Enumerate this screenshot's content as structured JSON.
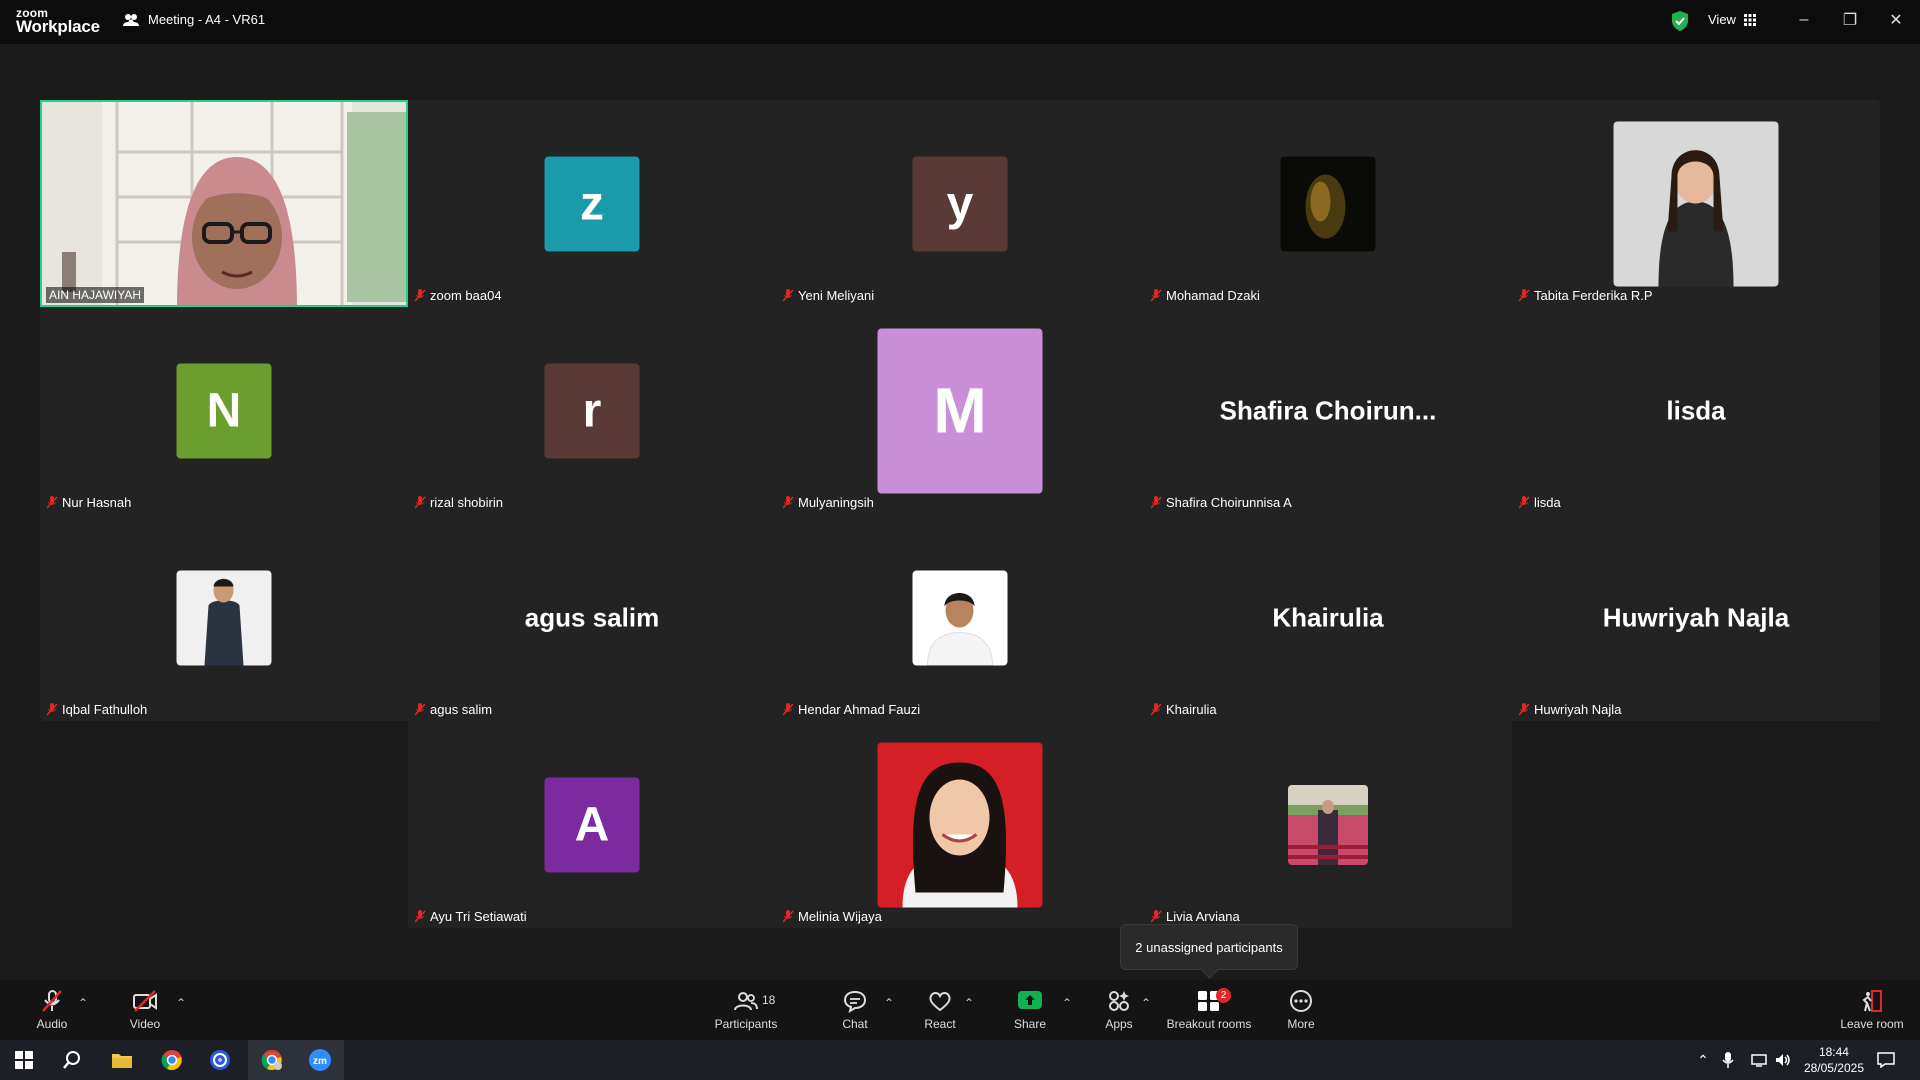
{
  "app": {
    "logo_line1": "zoom",
    "logo_line2": "Workplace",
    "meeting_title": "Meeting - A4 - VR61",
    "view_label": "View"
  },
  "tiles": [
    {
      "name": "AIN HAJAWIYAH",
      "type": "video"
    },
    {
      "name": "zoom baa04",
      "type": "letter",
      "letter": "z",
      "color": "#1a9aab"
    },
    {
      "name": "Yeni Meliyani",
      "type": "letter",
      "letter": "y",
      "color": "#5a3a36"
    },
    {
      "name": "Mohamad Dzaki",
      "type": "photo",
      "photo": "dark-portrait"
    },
    {
      "name": "Tabita Ferderika R.P",
      "type": "photo",
      "photo": "woman-portrait"
    },
    {
      "name": "Nur Hasnah",
      "type": "letter",
      "letter": "N",
      "color": "#6a9e2e"
    },
    {
      "name": "rizal shobirin",
      "type": "letter",
      "letter": "r",
      "color": "#5a3a36"
    },
    {
      "name": "Mulyaningsih",
      "type": "letter-big",
      "letter": "M",
      "color": "#c98fd9"
    },
    {
      "name": "Shafira Choirunnisa A",
      "type": "bigname",
      "display": "Shafira  Choirun..."
    },
    {
      "name": "lisda",
      "type": "bigname",
      "display": "lisda"
    },
    {
      "name": "Iqbal Fathulloh",
      "type": "photo",
      "photo": "man-portrait"
    },
    {
      "name": "agus salim",
      "type": "bigname",
      "display": "agus salim"
    },
    {
      "name": "Hendar Ahmad Fauzi",
      "type": "photo",
      "photo": "man-white-portrait"
    },
    {
      "name": "Khairulia",
      "type": "bigname",
      "display": "Khairulia"
    },
    {
      "name": "Huwriyah Najla",
      "type": "bigname",
      "display": "Huwriyah Najla"
    },
    {
      "name": "Ayu Tri Setiawati",
      "type": "letter",
      "letter": "A",
      "color": "#7b2aa0"
    },
    {
      "name": "Melinia Wijaya",
      "type": "photo",
      "photo": "woman-red-portrait"
    },
    {
      "name": "Livia Arviana",
      "type": "photo",
      "photo": "small-pink-photo"
    }
  ],
  "tooltip": "2 unassigned participants",
  "toolbar": {
    "audio": "Audio",
    "video": "Video",
    "participants": "Participants",
    "participants_count": "18",
    "chat": "Chat",
    "react": "React",
    "share": "Share",
    "apps": "Apps",
    "breakout": "Breakout rooms",
    "breakout_badge": "2",
    "more": "More",
    "leave": "Leave room"
  },
  "taskbar": {
    "time": "18:44",
    "date": "28/05/2025"
  },
  "colors": {
    "accent_green": "#23d18b",
    "share_green": "#0fb24f",
    "mute_red": "#e02828"
  }
}
